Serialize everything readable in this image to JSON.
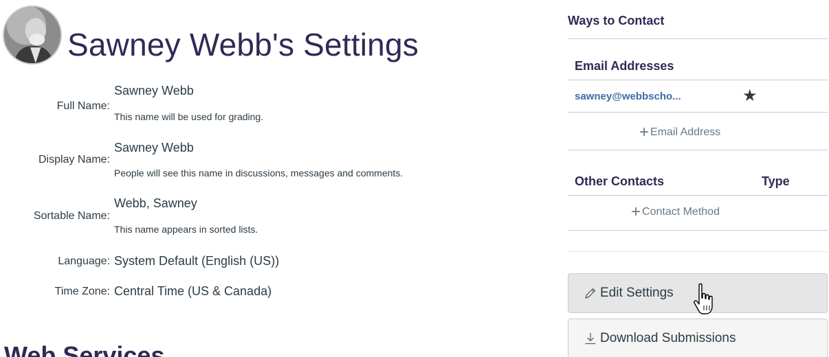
{
  "profile": {
    "title": "Sawney Webb's Settings",
    "avatar_icon": "user-portrait-avatar"
  },
  "fields": [
    {
      "label": "Full Name:",
      "value": "Sawney Webb",
      "hint": "This name will be used for grading."
    },
    {
      "label": "Display Name:",
      "value": "Sawney Webb",
      "hint": "People will see this name in discussions, messages and comments."
    },
    {
      "label": "Sortable Name:",
      "value": "Webb, Sawney",
      "hint": "This name appears in sorted lists."
    },
    {
      "label": "Language:",
      "value": "System Default (English (US))"
    },
    {
      "label": "Time Zone:",
      "value": "Central Time (US & Canada)"
    }
  ],
  "web_services": {
    "title": "Web Services"
  },
  "contact": {
    "heading": "Ways to Contact",
    "email_heading": "Email Addresses",
    "email": "sawney@webbscho...",
    "default_icon": "star-icon",
    "add_email": "Email Address",
    "other_heading": "Other Contacts",
    "type_heading": "Type",
    "add_contact": "Contact Method"
  },
  "actions": {
    "edit_settings": "Edit Settings",
    "download_submissions": "Download Submissions"
  },
  "colors": {
    "title": "#2d2b55",
    "link": "#3b6ea5",
    "muted": "#6a7883",
    "text": "#2d3b45"
  }
}
